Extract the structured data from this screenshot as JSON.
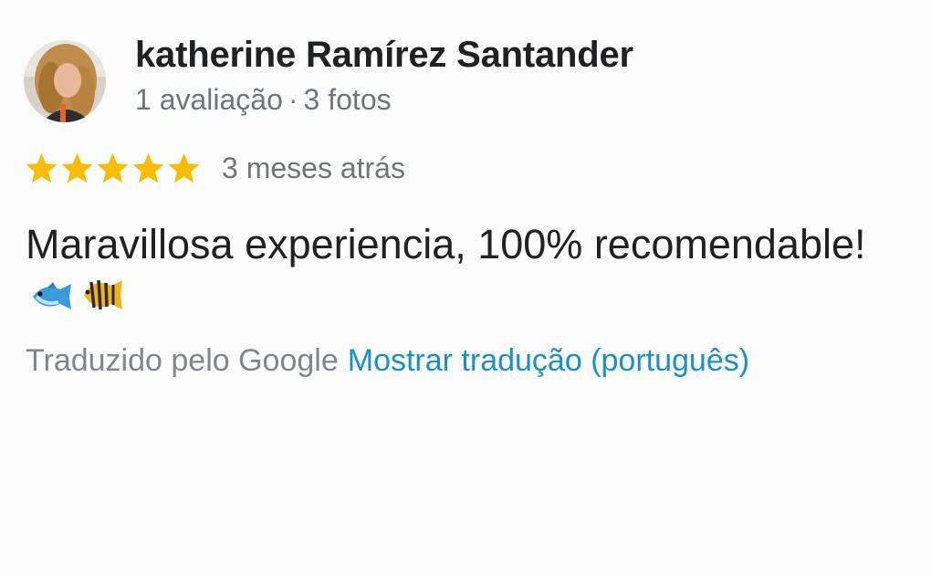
{
  "review": {
    "author": {
      "name": "katherine Ramírez Santander",
      "reviews_count": "1 avaliação",
      "separator": "·",
      "photos_count": "3 fotos"
    },
    "rating": 5,
    "time": "3 meses atrás",
    "text": "Maravillosa experiencia, 100% recomendable!",
    "emojis": [
      "fish-icon",
      "tropical-fish-icon"
    ],
    "translation": {
      "by_label": "Traduzido pelo Google",
      "show_link": "Mostrar tradução (português)"
    }
  },
  "colors": {
    "star": "#fbbc04",
    "link": "#1a8fc9",
    "meta_text": "#70757a",
    "primary_text": "#202124"
  }
}
